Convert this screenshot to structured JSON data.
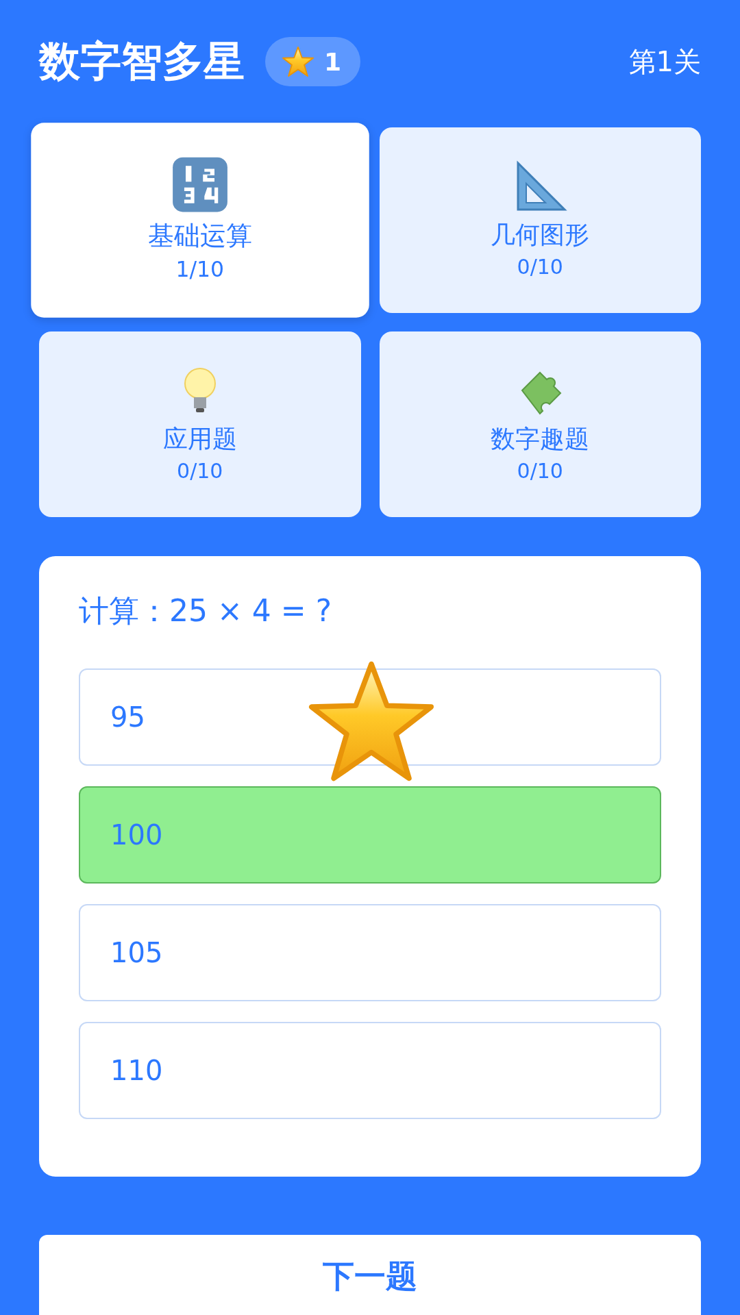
{
  "header": {
    "title": "数字智多星",
    "stars_badge": "1",
    "level": "第1关"
  },
  "categories": [
    {
      "name": "基础运算",
      "progress": "1/10",
      "selected": true
    },
    {
      "name": "几何图形",
      "progress": "0/10",
      "selected": false
    },
    {
      "name": "应用题",
      "progress": "0/10",
      "selected": false
    },
    {
      "name": "数字趣题",
      "progress": "0/10",
      "selected": false
    }
  ],
  "question": {
    "text": "计算：25 × 4 = ?",
    "star_reward": true,
    "options": [
      {
        "label": "95",
        "correct": false
      },
      {
        "label": "100",
        "correct": true
      },
      {
        "label": "105",
        "correct": false
      },
      {
        "label": "110",
        "correct": false
      }
    ]
  },
  "next_button": "下一题"
}
